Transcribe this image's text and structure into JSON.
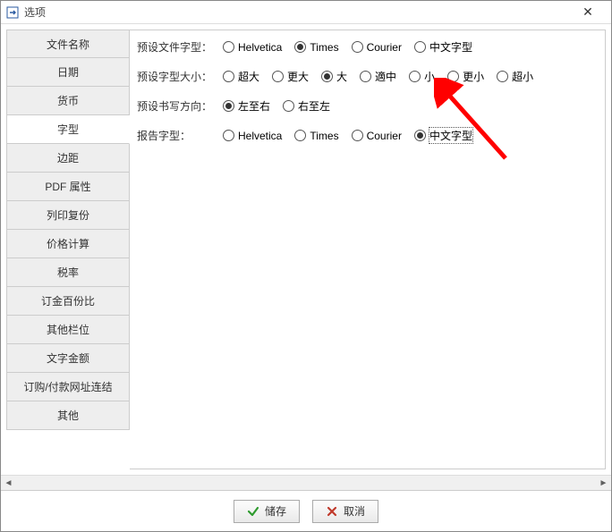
{
  "window": {
    "title": "选项"
  },
  "sidebar": {
    "items": [
      {
        "label": "文件名称"
      },
      {
        "label": "日期"
      },
      {
        "label": "货币"
      },
      {
        "label": "字型"
      },
      {
        "label": "边距"
      },
      {
        "label": "PDF 属性"
      },
      {
        "label": "列印复份"
      },
      {
        "label": "价格计算"
      },
      {
        "label": "税率"
      },
      {
        "label": "订金百份比"
      },
      {
        "label": "其他栏位"
      },
      {
        "label": "文字金额"
      },
      {
        "label": "订购/付款网址连结"
      },
      {
        "label": "其他"
      }
    ],
    "selected_index": 3
  },
  "content": {
    "rows": {
      "doc_font": {
        "label": "预设文件字型：",
        "options": [
          "Helvetica",
          "Times",
          "Courier",
          "中文字型"
        ],
        "selected": "Times"
      },
      "font_size": {
        "label": "预设字型大小：",
        "options": [
          "超大",
          "更大",
          "大",
          "適中",
          "小",
          "更小",
          "超小"
        ],
        "selected": "大"
      },
      "direction": {
        "label": "预设书写方向：",
        "options": [
          "左至右",
          "右至左"
        ],
        "selected": "左至右"
      },
      "report_font": {
        "label": "报告字型：",
        "options": [
          "Helvetica",
          "Times",
          "Courier",
          "中文字型"
        ],
        "selected": "中文字型",
        "focused": "中文字型"
      }
    }
  },
  "footer": {
    "save_label": "储存",
    "cancel_label": "取消"
  }
}
